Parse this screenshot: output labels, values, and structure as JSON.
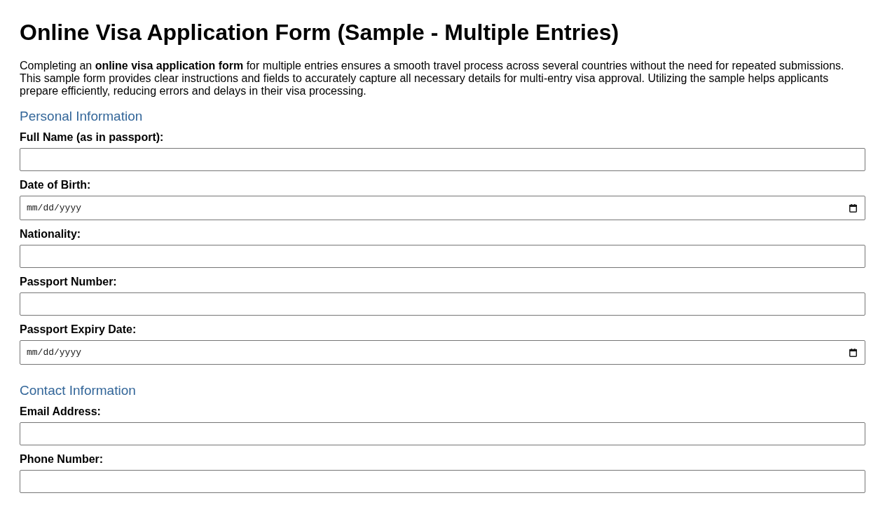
{
  "title": "Online Visa Application Form (Sample - Multiple Entries)",
  "intro": "Completing an **online visa application form** for multiple entries ensures a smooth travel process across several countries without the need for repeated submissions. This sample form provides clear instructions and fields to accurately capture all necessary details for multi-entry visa approval. Utilizing the sample helps applicants prepare efficiently, reducing errors and delays in their visa processing.",
  "sections": [
    {
      "heading": "Personal Information",
      "fields": [
        {
          "label": "Full Name (as in passport):",
          "kind": "text"
        },
        {
          "label": "Date of Birth:",
          "kind": "date",
          "placeholder": "mm/dd/yyyy"
        },
        {
          "label": "Nationality:",
          "kind": "text"
        },
        {
          "label": "Passport Number:",
          "kind": "text"
        },
        {
          "label": "Passport Expiry Date:",
          "kind": "date",
          "placeholder": "mm/dd/yyyy"
        }
      ]
    },
    {
      "heading": "Contact Information",
      "fields": [
        {
          "label": "Email Address:",
          "kind": "text"
        },
        {
          "label": "Phone Number:",
          "kind": "text"
        }
      ]
    }
  ]
}
